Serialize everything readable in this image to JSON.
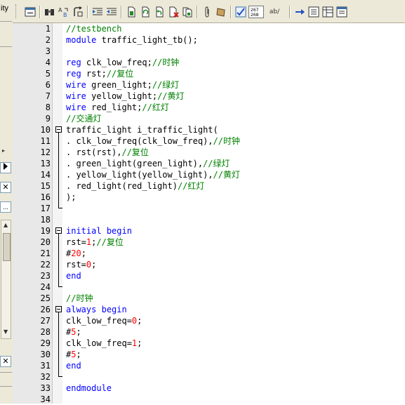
{
  "left_panel": {
    "top_text": "ity",
    "close_glyph": "✕",
    "more_glyph": "...",
    "expand_glyph": "▸"
  },
  "toolbar": {
    "icons": [
      "window-icon",
      "find-icon",
      "replace-icon",
      "goto-icon",
      "indent-icon",
      "outdent-icon",
      "save-icon",
      "refresh-icon",
      "undo-file-icon",
      "close-file-icon",
      "save-all-icon",
      "paperclip-icon",
      "scroll-icon",
      "spellcheck-icon",
      "hex-view-icon",
      "word-wrap-icon",
      "arrow-right-icon",
      "list-icon",
      "table-icon",
      "columns-icon"
    ],
    "hex_label_top": "267",
    "hex_label_bottom": "268",
    "wrap_label": "ab/"
  },
  "code": {
    "lines": [
      {
        "n": "1",
        "parts": [
          {
            "t": "//testbench",
            "c": "cm"
          }
        ]
      },
      {
        "n": "2",
        "parts": [
          {
            "t": "module",
            "c": "kw"
          },
          {
            "t": " traffic_light_tb();",
            "c": ""
          }
        ]
      },
      {
        "n": "3",
        "parts": []
      },
      {
        "n": "4",
        "parts": [
          {
            "t": "reg",
            "c": "kw"
          },
          {
            "t": " clk_low_freq;",
            "c": ""
          },
          {
            "t": "//时钟",
            "c": "cm"
          }
        ]
      },
      {
        "n": "5",
        "parts": [
          {
            "t": "reg",
            "c": "kw"
          },
          {
            "t": " rst;",
            "c": ""
          },
          {
            "t": "//复位",
            "c": "cm"
          }
        ]
      },
      {
        "n": "6",
        "parts": [
          {
            "t": "wire",
            "c": "kw"
          },
          {
            "t": " green_light;",
            "c": ""
          },
          {
            "t": "//绿灯",
            "c": "cm"
          }
        ]
      },
      {
        "n": "7",
        "parts": [
          {
            "t": "wire",
            "c": "kw"
          },
          {
            "t": " yellow_light;",
            "c": ""
          },
          {
            "t": "//黄灯",
            "c": "cm"
          }
        ]
      },
      {
        "n": "8",
        "parts": [
          {
            "t": "wire",
            "c": "kw"
          },
          {
            "t": " red_light;",
            "c": ""
          },
          {
            "t": "//红灯",
            "c": "cm"
          }
        ]
      },
      {
        "n": "9",
        "parts": [
          {
            "t": "//交通灯",
            "c": "cm"
          }
        ]
      },
      {
        "n": "10",
        "parts": [
          {
            "t": "traffic_light i_traffic_light(",
            "c": ""
          }
        ]
      },
      {
        "n": "11",
        "parts": [
          {
            "t": ". clk_low_freq(clk_low_freq),",
            "c": ""
          },
          {
            "t": "//时钟",
            "c": "cm"
          }
        ]
      },
      {
        "n": "12",
        "parts": [
          {
            "t": ". rst(rst),",
            "c": ""
          },
          {
            "t": "//复位",
            "c": "cm"
          }
        ]
      },
      {
        "n": "13",
        "parts": [
          {
            "t": ". green_light(green_light),",
            "c": ""
          },
          {
            "t": "//绿灯",
            "c": "cm"
          }
        ]
      },
      {
        "n": "14",
        "parts": [
          {
            "t": ". yellow_light(yellow_light),",
            "c": ""
          },
          {
            "t": "//黄灯",
            "c": "cm"
          }
        ]
      },
      {
        "n": "15",
        "parts": [
          {
            "t": ". red_light(red_light)",
            "c": ""
          },
          {
            "t": "//红灯",
            "c": "cm"
          }
        ]
      },
      {
        "n": "16",
        "parts": [
          {
            "t": ");",
            "c": ""
          }
        ]
      },
      {
        "n": "17",
        "parts": []
      },
      {
        "n": "18",
        "parts": []
      },
      {
        "n": "19",
        "parts": [
          {
            "t": "initial",
            "c": "kw"
          },
          {
            "t": " ",
            "c": ""
          },
          {
            "t": "begin",
            "c": "kw"
          }
        ]
      },
      {
        "n": "20",
        "parts": [
          {
            "t": "rst=",
            "c": ""
          },
          {
            "t": "1",
            "c": "num"
          },
          {
            "t": ";",
            "c": ""
          },
          {
            "t": "//复位",
            "c": "cm"
          }
        ]
      },
      {
        "n": "21",
        "parts": [
          {
            "t": "#",
            "c": ""
          },
          {
            "t": "20",
            "c": "num"
          },
          {
            "t": ";",
            "c": ""
          }
        ]
      },
      {
        "n": "22",
        "parts": [
          {
            "t": "rst=",
            "c": ""
          },
          {
            "t": "0",
            "c": "num"
          },
          {
            "t": ";",
            "c": ""
          }
        ]
      },
      {
        "n": "23",
        "parts": [
          {
            "t": "end",
            "c": "kw"
          }
        ]
      },
      {
        "n": "24",
        "parts": []
      },
      {
        "n": "25",
        "parts": [
          {
            "t": "//时钟",
            "c": "cm"
          }
        ]
      },
      {
        "n": "26",
        "parts": [
          {
            "t": "always",
            "c": "kw"
          },
          {
            "t": " ",
            "c": ""
          },
          {
            "t": "begin",
            "c": "kw"
          }
        ]
      },
      {
        "n": "27",
        "parts": [
          {
            "t": "clk_low_freq=",
            "c": ""
          },
          {
            "t": "0",
            "c": "num"
          },
          {
            "t": ";",
            "c": ""
          }
        ]
      },
      {
        "n": "28",
        "parts": [
          {
            "t": "#",
            "c": ""
          },
          {
            "t": "5",
            "c": "num"
          },
          {
            "t": ";",
            "c": ""
          }
        ]
      },
      {
        "n": "29",
        "parts": [
          {
            "t": "clk_low_freq=",
            "c": ""
          },
          {
            "t": "1",
            "c": "num"
          },
          {
            "t": ";",
            "c": ""
          }
        ]
      },
      {
        "n": "30",
        "parts": [
          {
            "t": "#",
            "c": ""
          },
          {
            "t": "5",
            "c": "num"
          },
          {
            "t": ";",
            "c": ""
          }
        ]
      },
      {
        "n": "31",
        "parts": [
          {
            "t": "end",
            "c": "kw"
          }
        ]
      },
      {
        "n": "32",
        "parts": []
      },
      {
        "n": "33",
        "parts": [
          {
            "t": "endmodule",
            "c": "kw"
          }
        ]
      },
      {
        "n": "34",
        "parts": []
      }
    ]
  },
  "colors": {
    "keyword": "#0000ff",
    "comment": "#008000",
    "number": "#ff0000",
    "gutter": "#e8e8e8",
    "toolbar": "#ece9d8"
  }
}
